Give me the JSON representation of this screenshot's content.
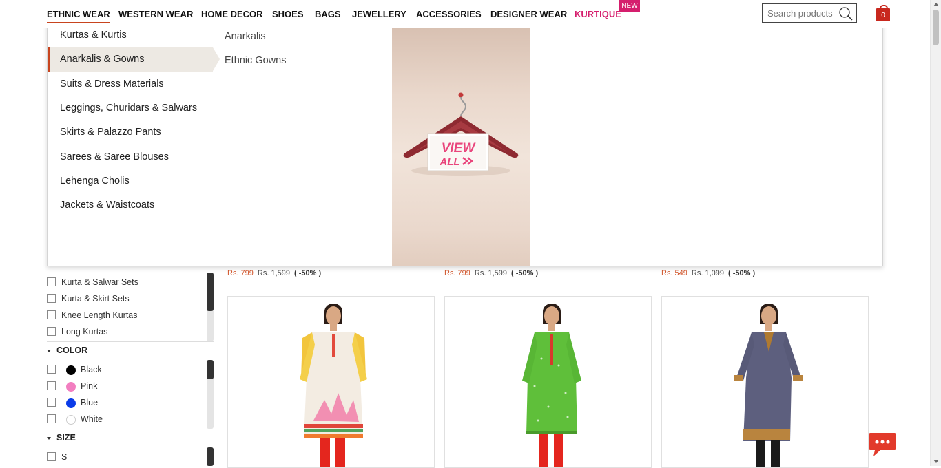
{
  "nav": {
    "items": [
      "ETHNIC WEAR",
      "WESTERN WEAR",
      "HOME DECOR",
      "SHOES",
      "BAGS",
      "JEWELLERY",
      "ACCESSORIES",
      "DESIGNER WEAR",
      "KURTIQUE"
    ],
    "new_badge": "NEW",
    "search_placeholder": "Search products",
    "cart_count": "0"
  },
  "mega_menu": {
    "categories": [
      "Kurtas & Kurtis",
      "Anarkalis & Gowns",
      "Suits & Dress Materials",
      "Leggings, Churidars & Salwars",
      "Skirts & Palazzo Pants",
      "Sarees & Saree Blouses",
      "Lehenga Cholis",
      "Jackets & Waistcoats"
    ],
    "active_category": "Anarkalis & Gowns",
    "subcategories": [
      "Anarkalis",
      "Ethnic Gowns"
    ],
    "promo_text_1": "VIEW",
    "promo_text_2": "ALL"
  },
  "filters": {
    "type_items": [
      "Kurta & Salwar Sets",
      "Kurta & Skirt Sets",
      "Knee Length Kurtas",
      "Long Kurtas"
    ],
    "color": {
      "title": "COLOR",
      "items": [
        {
          "label": "Black",
          "color": "#000000"
        },
        {
          "label": "Pink",
          "color": "#f27ec0"
        },
        {
          "label": "Blue",
          "color": "#0a3be8"
        },
        {
          "label": "White",
          "color": "#ffffff"
        }
      ]
    },
    "size": {
      "title": "SIZE",
      "items": [
        "S"
      ]
    }
  },
  "prices": [
    {
      "now": "Rs. 799",
      "was": "Rs. 1,599",
      "discount": "( -50% )"
    },
    {
      "now": "Rs. 799",
      "was": "Rs. 1,599",
      "discount": "( -50% )"
    },
    {
      "now": "Rs. 549",
      "was": "Rs. 1,099",
      "discount": "( -50% )"
    }
  ],
  "colors": {
    "accent": "#c8441e",
    "brand_pink": "#d51e6d",
    "price": "#d2552a"
  }
}
